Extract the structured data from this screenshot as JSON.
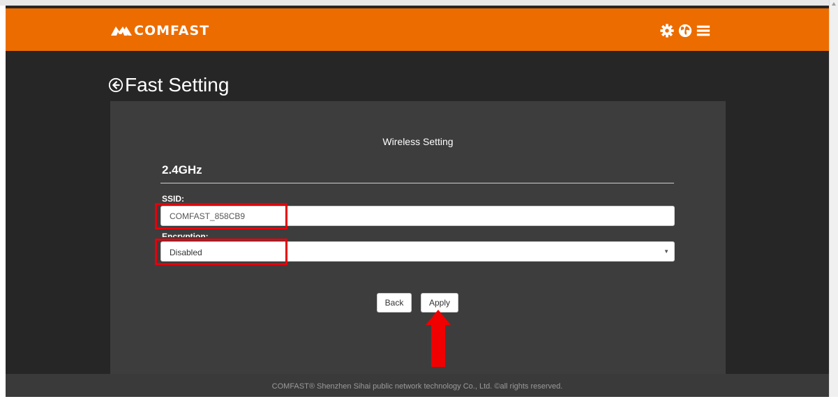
{
  "brand": {
    "name": "COMFAST"
  },
  "header": {
    "icons": [
      "settings-gear-icon",
      "globe-language-icon",
      "menu-hamburger-icon"
    ]
  },
  "page": {
    "title": "Fast Setting"
  },
  "wireless": {
    "section_title": "Wireless Setting",
    "band": "2.4GHz",
    "ssid_label": "SSID:",
    "ssid_value": "COMFAST_858CB9",
    "encryption_label": "Encryption:",
    "encryption_value": "Disabled"
  },
  "buttons": {
    "back": "Back",
    "apply": "Apply"
  },
  "footer": {
    "text": "COMFAST® Shenzhen Sihai public network technology Co., Ltd. ©all rights reserved."
  },
  "colors": {
    "brand_orange": "#ec6c00",
    "background": "#262626",
    "panel": "#3d3d3d",
    "highlight_red": "#e8000b"
  }
}
